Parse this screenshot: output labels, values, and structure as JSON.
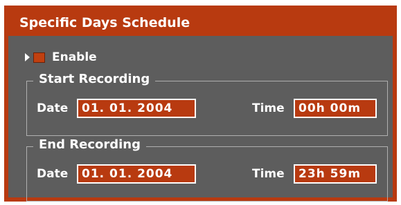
{
  "title": "Specific Days Schedule",
  "enable": {
    "label": "Enable"
  },
  "start": {
    "legend": "Start Recording",
    "date_label": "Date",
    "date_value": "01. 01. 2004",
    "time_label": "Time",
    "time_value": "00h 00m"
  },
  "end": {
    "legend": "End Recording",
    "date_label": "Date",
    "date_value": "01. 01. 2004",
    "time_label": "Time",
    "time_value": "23h 59m"
  },
  "colors": {
    "accent": "#b83a10",
    "panel_bg": "#5d5d5d",
    "text": "#ffffff"
  }
}
